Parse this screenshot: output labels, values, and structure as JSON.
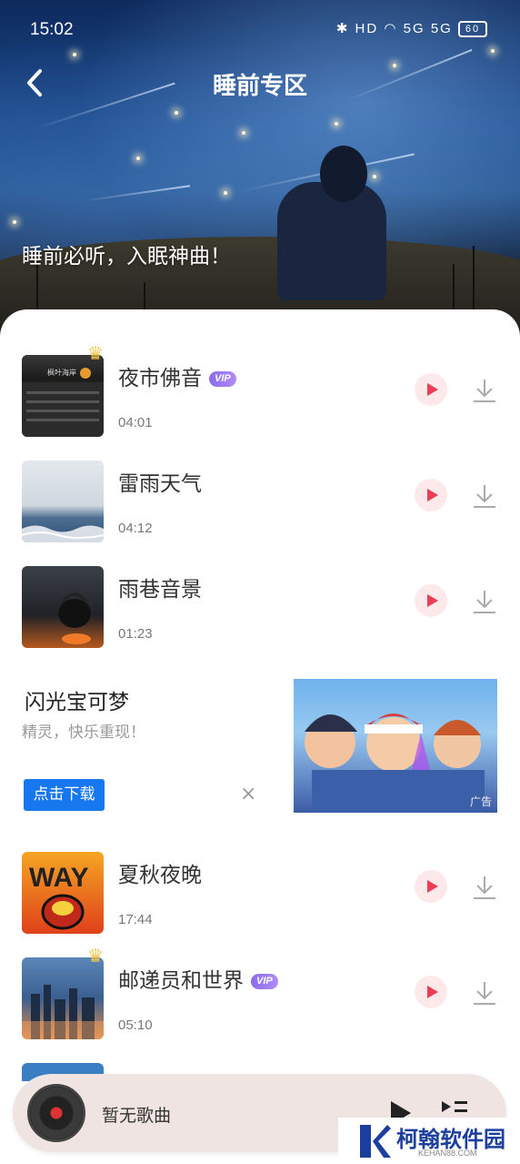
{
  "status_bar": {
    "time": "15:02",
    "icons": "✱ HD ◠ 5G 5G",
    "battery": "60"
  },
  "header": {
    "title": "睡前专区",
    "subtitle": "睡前必听，入眠神曲！"
  },
  "songs": [
    {
      "title": "夜市佛音",
      "vip": true,
      "vip_label": "VIP",
      "duration": "04:01",
      "thumb_text": "枫叶海岸"
    },
    {
      "title": "雷雨天气",
      "vip": false,
      "duration": "04:12"
    },
    {
      "title": "雨巷音景",
      "vip": false,
      "duration": "01:23"
    },
    {
      "title": "夏秋夜晚",
      "vip": false,
      "duration": "17:44",
      "thumb_text": "WAY"
    },
    {
      "title": "邮递员和世界",
      "vip": true,
      "vip_label": "VIP",
      "duration": "05:10"
    }
  ],
  "ad": {
    "title": "闪光宝可梦",
    "description": "精灵，快乐重现！",
    "button": "点击下载",
    "close": "×",
    "tag": "广告"
  },
  "player": {
    "text": "暂无歌曲"
  },
  "watermark": {
    "brand": "柯翰软件园",
    "url": "KEHAN88.COM"
  },
  "colors": {
    "accent": "#ec3d55",
    "vip": "#8b6cf0",
    "ad_button": "#1677ef",
    "player_bg": "#f0e4e3"
  }
}
